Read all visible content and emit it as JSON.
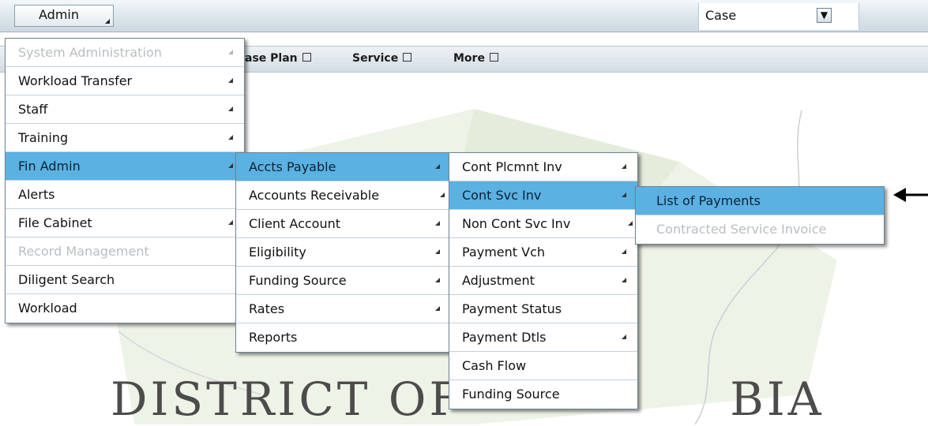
{
  "topbar": {
    "admin_label": "Admin",
    "case_select_value": "Case"
  },
  "navbar": {
    "items": [
      {
        "label": "ase Plan"
      },
      {
        "label": "Service"
      },
      {
        "label": "More"
      }
    ]
  },
  "watermark": {
    "text": "DISTRICT OF               BIA"
  },
  "admin_menu": {
    "items": [
      {
        "label": "System Administration",
        "disabled": true,
        "submenu": true
      },
      {
        "label": "Workload Transfer",
        "submenu": true
      },
      {
        "label": "Staff",
        "submenu": true
      },
      {
        "label": "Training",
        "submenu": true
      },
      {
        "label": "Fin Admin",
        "highlighted": true,
        "submenu": true
      },
      {
        "label": "Alerts"
      },
      {
        "label": "File Cabinet",
        "submenu": true
      },
      {
        "label": "Record Management",
        "disabled": true
      },
      {
        "label": "Diligent Search"
      },
      {
        "label": "Workload"
      }
    ]
  },
  "fin_admin_menu": {
    "items": [
      {
        "label": "Accts Payable",
        "highlighted": true,
        "submenu": true
      },
      {
        "label": "Accounts Receivable",
        "submenu": true
      },
      {
        "label": "Client Account",
        "submenu": true
      },
      {
        "label": "Eligibility",
        "submenu": true
      },
      {
        "label": "Funding Source",
        "submenu": true
      },
      {
        "label": "Rates",
        "submenu": true
      },
      {
        "label": "Reports"
      }
    ]
  },
  "accts_payable_menu": {
    "items": [
      {
        "label": "Cont Plcmnt Inv",
        "submenu": true
      },
      {
        "label": "Cont Svc Inv",
        "highlighted": true,
        "submenu": true
      },
      {
        "label": "Non Cont Svc Inv",
        "submenu": true
      },
      {
        "label": "Payment Vch",
        "submenu": true
      },
      {
        "label": "Adjustment",
        "submenu": true
      },
      {
        "label": "Payment Status"
      },
      {
        "label": "Payment Dtls",
        "submenu": true
      },
      {
        "label": "Cash Flow"
      },
      {
        "label": "Funding Source"
      }
    ]
  },
  "cont_svc_inv_menu": {
    "items": [
      {
        "label": "List of Payments",
        "highlighted": true
      },
      {
        "label": "Contracted Service Invoice",
        "disabled": true
      }
    ]
  },
  "colors": {
    "highlight": "#5bb1e2",
    "disabled_text": "#b9bec2",
    "map_background": "#eef3e8"
  }
}
